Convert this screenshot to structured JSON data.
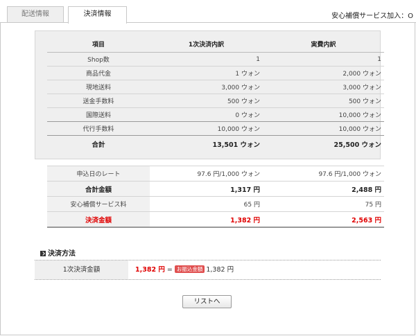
{
  "tabs": [
    {
      "label": "配送情報",
      "active": false
    },
    {
      "label": "決済情報",
      "active": true
    }
  ],
  "insurance": {
    "label": "安心補償サービス加入：",
    "value": "O"
  },
  "breakdown": {
    "headers": [
      "項目",
      "1次決済内訳",
      "実費内訳"
    ],
    "rows": [
      {
        "item": "Shop数",
        "first": "1",
        "actual": "1"
      },
      {
        "item": "商品代金",
        "first": "1 ウォン",
        "actual": "2,000 ウォン"
      },
      {
        "item": "現地送料",
        "first": "3,000 ウォン",
        "actual": "3,000 ウォン"
      },
      {
        "item": "送金手数料",
        "first": "500 ウォン",
        "actual": "500 ウォン"
      },
      {
        "item": "国際送料",
        "first": "0 ウォン",
        "actual": "10,000 ウォン"
      },
      {
        "item": "代行手数料",
        "first": "10,000 ウォン",
        "actual": "10,000 ウォン"
      }
    ],
    "total": {
      "item": "合計",
      "first": "13,501 ウォン",
      "actual": "25,500 ウォン"
    }
  },
  "summary": {
    "rows": [
      {
        "item": "申込日のレート",
        "first": "97.6 円/1,000 ウォン",
        "actual": "97.6 円/1,000 ウォン"
      },
      {
        "item": "合計金額",
        "first": "1,317 円",
        "actual": "2,488 円"
      },
      {
        "item": "安心補償サービス料",
        "first": "65 円",
        "actual": "75 円"
      },
      {
        "item": "決済金額",
        "first": "1,382 円",
        "actual": "2,563 円"
      }
    ]
  },
  "payment_method": {
    "title": "決済方法",
    "label": "1次決済金額",
    "amount": "1,382 円",
    "equals": "=",
    "badge": "お振込金額",
    "transfer": "1,382 円"
  },
  "list_button": "リストへ",
  "colors": {
    "accent_red": "#e00000",
    "badge_red": "#e05050",
    "panel_bg": "#efefef"
  }
}
